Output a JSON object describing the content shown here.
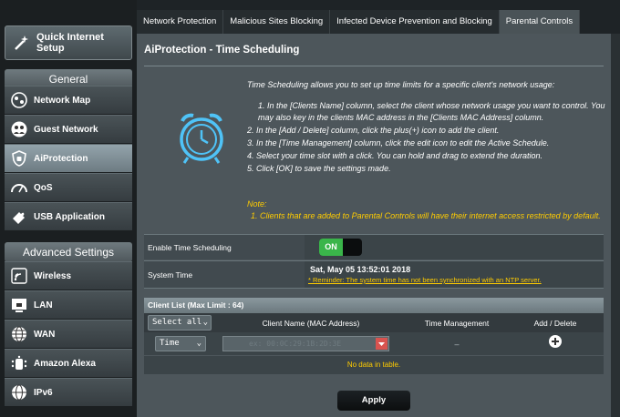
{
  "sidebar": {
    "quick_setup": "Quick Internet Setup",
    "general_header": "General",
    "general_items": [
      {
        "label": "Network Map",
        "icon": "network-map-icon"
      },
      {
        "label": "Guest Network",
        "icon": "guest-network-icon"
      },
      {
        "label": "AiProtection",
        "icon": "shield-icon",
        "active": true
      },
      {
        "label": "QoS",
        "icon": "gauge-icon"
      },
      {
        "label": "USB Application",
        "icon": "puzzle-icon"
      }
    ],
    "advanced_header": "Advanced Settings",
    "advanced_items": [
      {
        "label": "Wireless",
        "icon": "wifi-icon"
      },
      {
        "label": "LAN",
        "icon": "lan-icon"
      },
      {
        "label": "WAN",
        "icon": "globe-icon"
      },
      {
        "label": "Amazon Alexa",
        "icon": "alexa-icon"
      },
      {
        "label": "IPv6",
        "icon": "ipv6-icon"
      }
    ]
  },
  "tabs": [
    {
      "label": "Network Protection"
    },
    {
      "label": "Malicious Sites Blocking"
    },
    {
      "label": "Infected Device Prevention and Blocking"
    },
    {
      "label": "Parental Controls",
      "active": true
    }
  ],
  "main": {
    "title": "AiProtection - Time Scheduling",
    "intro": "Time Scheduling allows you to set up time limits for a specific client's network usage:",
    "steps": [
      "1. In the [Clients Name] column, select the client whose network usage you want to control. You may also key in the clients MAC address in the [Clients MAC Address] column.",
      "2. In the [Add / Delete] column, click the plus(+) icon to add the client.",
      "3. In the [Time Management] column, click the edit icon to edit the Active Schedule.",
      "4. Select your time slot with a click. You can hold and drag to extend the duration.",
      "5. Click [OK] to save the settings made."
    ],
    "note_label": "Note:",
    "note_text": "1. Clients that are added to Parental Controls will have their internet access restricted by default.",
    "enable_label": "Enable Time Scheduling",
    "toggle_on": "ON",
    "system_time_label": "System Time",
    "system_time_value": "Sat, May 05 13:52:01 2018",
    "reminder": "* Reminder: The system time has not been synchronized with an NTP server.",
    "client_list_header": "Client List (Max Limit : 64)",
    "columns": {
      "select": "Select all",
      "client_name": "Client Name (MAC Address)",
      "time_mgmt": "Time Management",
      "add_delete": "Add / Delete"
    },
    "row_select": "Time",
    "row_client_placeholder": "ex: 00:0C:29:1B:2D:3E",
    "row_time_mgmt": "–",
    "no_data": "No data in table.",
    "apply": "Apply"
  }
}
